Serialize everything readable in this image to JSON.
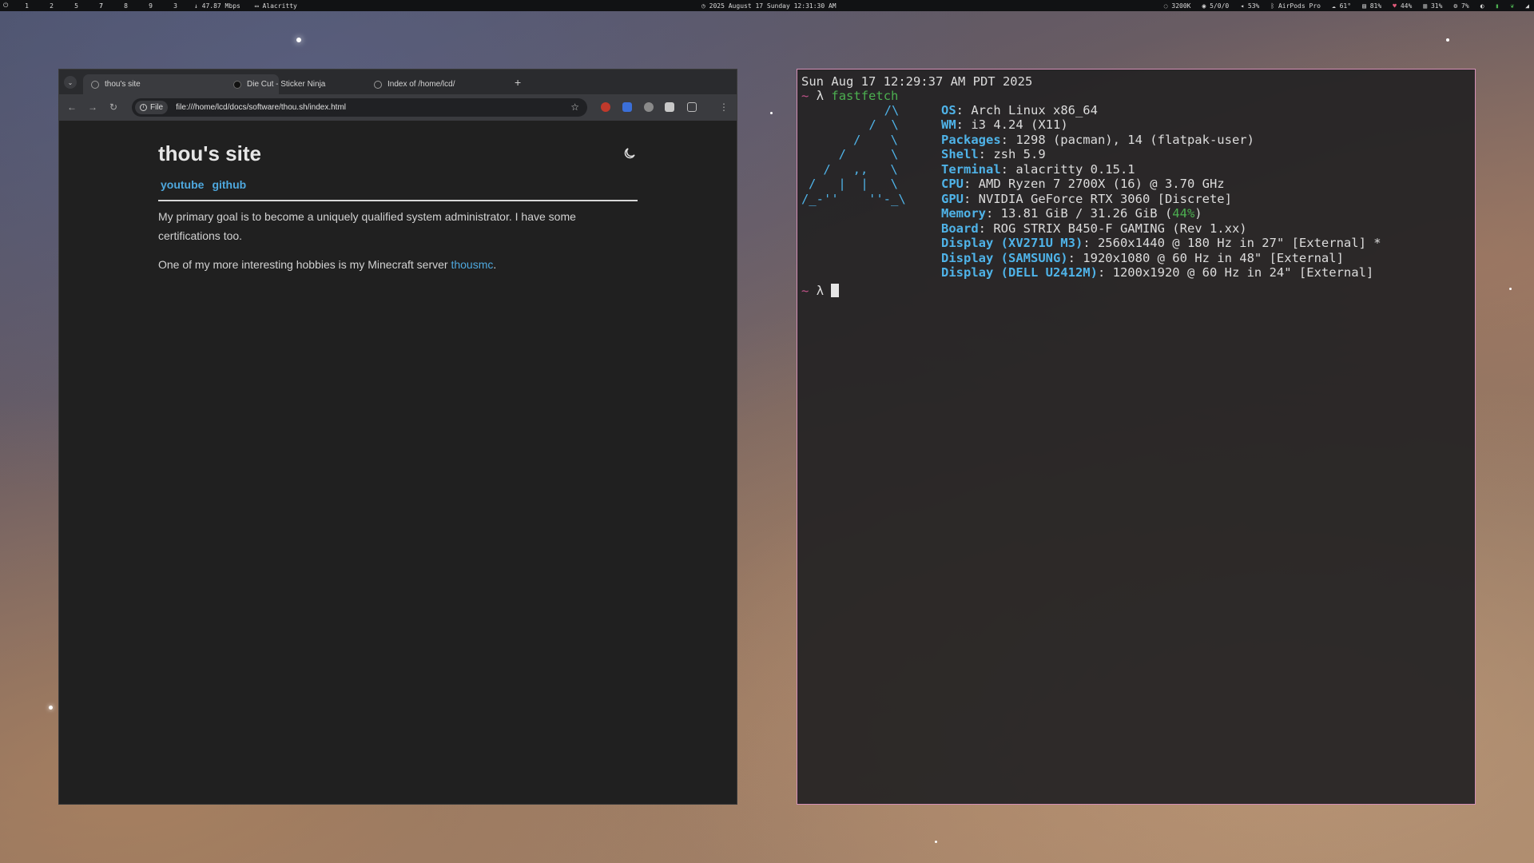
{
  "topbar": {
    "workspaces": [
      "1",
      "2",
      "5",
      "7",
      "8",
      "9",
      "3"
    ],
    "net_speed": "47.87 Mbps",
    "active_window": "Alacritty",
    "datetime": "2025 August 17 Sunday 12:31:30 AM",
    "status": {
      "color_temp": "3200K",
      "updates": "5/0/0",
      "volume": "53%",
      "bluetooth": "AirPods Pro",
      "temp": "61°",
      "cpu": "81%",
      "gpu": "44%",
      "mem": "31%",
      "disk": "7%"
    }
  },
  "browser": {
    "tabs": [
      {
        "label": "thou's site"
      },
      {
        "label": "Die Cut - Sticker Ninja"
      },
      {
        "label": "Index of /home/lcd/"
      }
    ],
    "new_tab_label": "+",
    "omnibox": {
      "chip_label": "File",
      "url": "file:///home/lcd/docs/software/thou.sh/index.html"
    },
    "page": {
      "title": "thou's site",
      "nav": [
        "youtube",
        "github"
      ],
      "para1": "My primary goal is to become a uniquely qualified system administrator. I have some certifications too.",
      "para2_prefix": "One of my more interesting hobbies is my Minecraft server ",
      "para2_link": "thousmc",
      "para2_suffix": "."
    }
  },
  "terminal": {
    "header": "Sun Aug 17 12:29:37 AM PDT 2025",
    "prompt_tilde": "~",
    "prompt_lambda": "λ",
    "command": "fastfetch",
    "logo": [
      "     /\\",
      "    /  \\",
      "   /    \\",
      "  /      \\",
      " /   ,,   \\",
      "/   |  |   \\",
      "/_-''    ''-_\\"
    ],
    "info": [
      {
        "key": "OS",
        "value": ": Arch Linux x86_64"
      },
      {
        "key": "WM",
        "value": ": i3 4.24 (X11)"
      },
      {
        "key": "Packages",
        "value": ": 1298 (pacman), 14 (flatpak-user)"
      },
      {
        "key": "Shell",
        "value": ": zsh 5.9"
      },
      {
        "key": "Terminal",
        "value": ": alacritty 0.15.1"
      },
      {
        "key": "CPU",
        "value": ": AMD Ryzen 7 2700X (16) @ 3.70 GHz"
      },
      {
        "key": "GPU",
        "value": ": NVIDIA GeForce RTX 3060 [Discrete]"
      },
      {
        "key": "Memory",
        "value_pre": ": 13.81 GiB / 31.26 GiB (",
        "value_hl": "44%",
        "value_post": ")"
      },
      {
        "key": "Board",
        "value": ": ROG STRIX B450-F GAMING (Rev 1.xx)"
      },
      {
        "key": "Display (XV271U M3)",
        "value": ": 2560x1440 @ 180 Hz in 27\" [External] *"
      },
      {
        "key": "Display (SAMSUNG)",
        "value": ": 1920x1080 @ 60 Hz in 48\" [External]"
      },
      {
        "key": "Display (DELL U2412M)",
        "value": ": 1200x1920 @ 60 Hz in 24\" [External]"
      }
    ]
  },
  "colors": {
    "terminal_border": "#d48fb6",
    "link": "#4ea8de",
    "fetch_key": "#4fb3e8",
    "accent_green": "#4caf50"
  }
}
